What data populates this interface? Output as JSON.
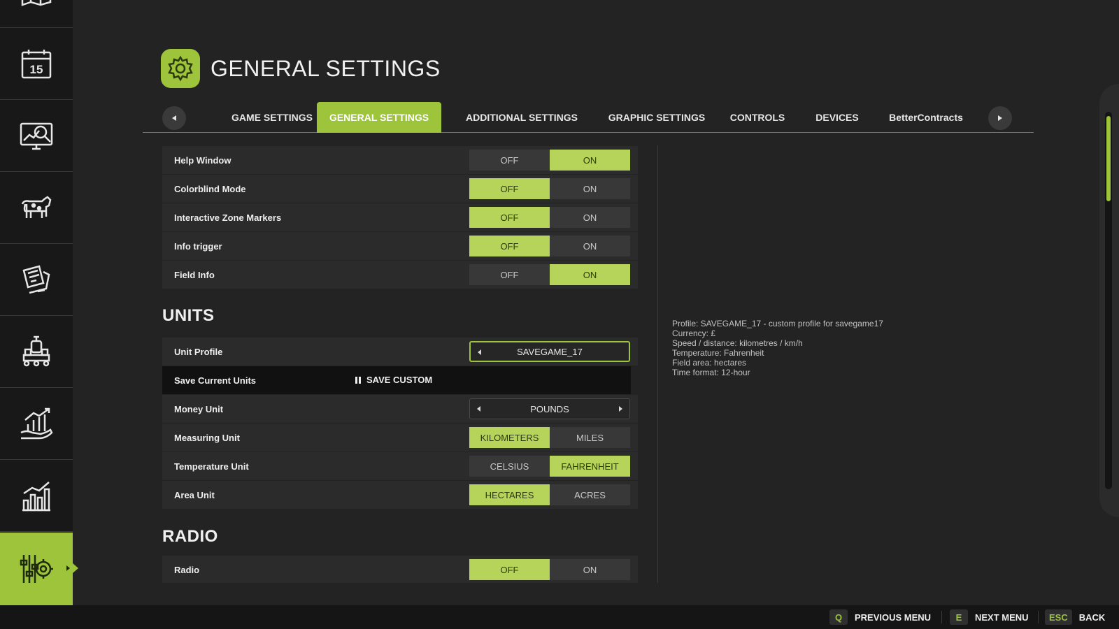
{
  "header": {
    "title": "GENERAL SETTINGS",
    "icon": "gear-icon"
  },
  "colors": {
    "accent": "#9dc43a",
    "selected_option": "#b7d45a",
    "background": "#232323",
    "sidebar": "#181818"
  },
  "sidebar": {
    "items": [
      {
        "icon": "map-icon"
      },
      {
        "icon": "calendar-icon",
        "day": "15"
      },
      {
        "icon": "price-monitor-icon"
      },
      {
        "icon": "animals-icon"
      },
      {
        "icon": "contracts-icon"
      },
      {
        "icon": "production-icon"
      },
      {
        "icon": "finances-icon"
      },
      {
        "icon": "statistics-icon"
      },
      {
        "icon": "settings-icon",
        "active": true
      }
    ]
  },
  "tabs": [
    {
      "label": "GAME SETTINGS"
    },
    {
      "label": "GENERAL SETTINGS",
      "active": true
    },
    {
      "label": "ADDITIONAL SETTINGS"
    },
    {
      "label": "GRAPHIC SETTINGS"
    },
    {
      "label": "CONTROLS"
    },
    {
      "label": "DEVICES"
    },
    {
      "label": "BetterContracts"
    }
  ],
  "general": [
    {
      "label": "Help Window",
      "options": [
        "OFF",
        "ON"
      ],
      "selected": 1
    },
    {
      "label": "Colorblind Mode",
      "options": [
        "OFF",
        "ON"
      ],
      "selected": 0
    },
    {
      "label": "Interactive Zone Markers",
      "options": [
        "OFF",
        "ON"
      ],
      "selected": 0
    },
    {
      "label": "Info trigger",
      "options": [
        "OFF",
        "ON"
      ],
      "selected": 0
    },
    {
      "label": "Field Info",
      "options": [
        "OFF",
        "ON"
      ],
      "selected": 1
    }
  ],
  "units": {
    "title": "UNITS",
    "unit_profile": {
      "label": "Unit Profile",
      "value": "SAVEGAME_17"
    },
    "save_current": {
      "label": "Save Current Units",
      "button": "SAVE CUSTOM"
    },
    "money_unit": {
      "label": "Money Unit",
      "value": "POUNDS"
    },
    "toggles": [
      {
        "label": "Measuring Unit",
        "options": [
          "KILOMETERS",
          "MILES"
        ],
        "selected": 0
      },
      {
        "label": "Temperature Unit",
        "options": [
          "CELSIUS",
          "FAHRENHEIT"
        ],
        "selected": 1
      },
      {
        "label": "Area Unit",
        "options": [
          "HECTARES",
          "ACRES"
        ],
        "selected": 0
      }
    ]
  },
  "radio": {
    "title": "RADIO",
    "row": {
      "label": "Radio",
      "options": [
        "OFF",
        "ON"
      ],
      "selected": 0
    }
  },
  "info": {
    "lines": [
      "Profile: SAVEGAME_17 - custom profile for savegame17",
      "Currency: £",
      "Speed / distance: kilometres / km/h",
      "Temperature: Fahrenheit",
      "Field area: hectares",
      "Time format: 12-hour"
    ]
  },
  "footer": [
    {
      "key": "Q",
      "label": "PREVIOUS MENU"
    },
    {
      "key": "E",
      "label": "NEXT MENU"
    },
    {
      "key": "ESC",
      "label": "BACK"
    }
  ]
}
